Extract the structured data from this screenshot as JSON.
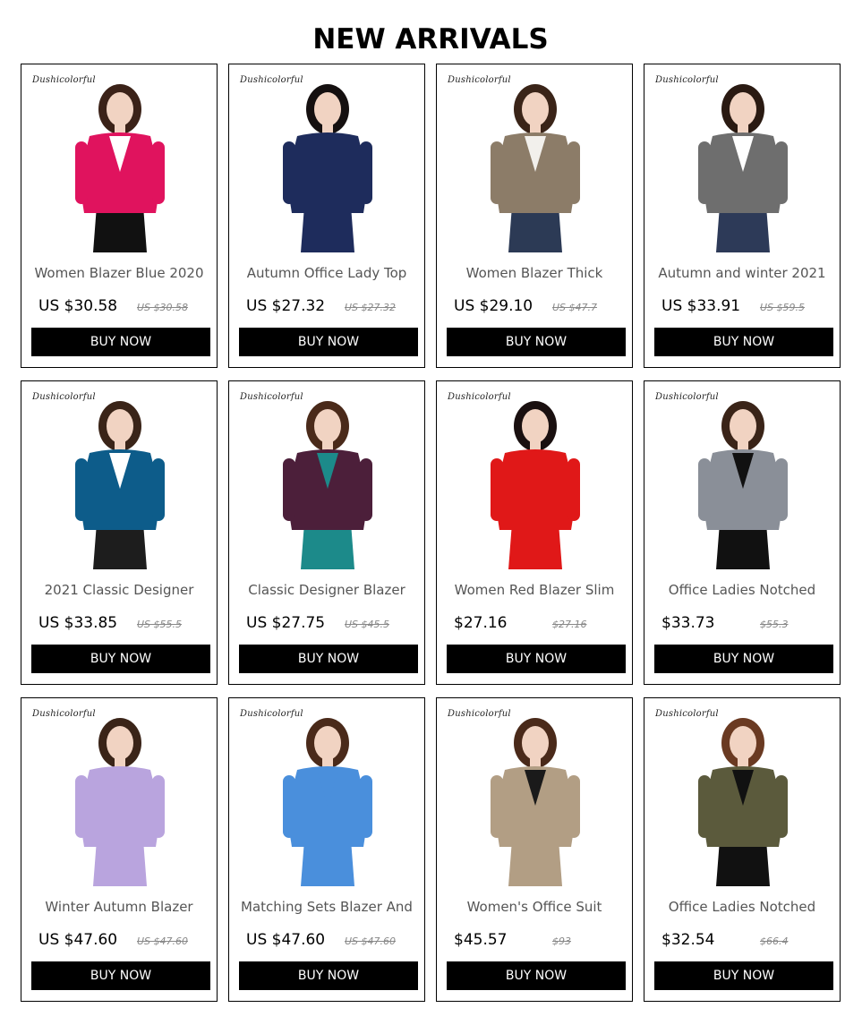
{
  "page": {
    "title": "NEW ARRIVALS"
  },
  "brand": "Dushicolorful",
  "buy_label": "BUY NOW",
  "products": [
    {
      "title": "Women Blazer Blue 2020",
      "price": "US $30.58",
      "old_price": "US $30.58",
      "jacket": "#e0135e",
      "inner": "#ffffff",
      "bottom": "#111111",
      "hair": "#3b2218",
      "hat": ""
    },
    {
      "title": "Autumn Office Lady Top",
      "price": "US $27.32",
      "old_price": "US $27.32",
      "jacket": "#1e2c5c",
      "inner": "#1e2c5c",
      "bottom": "#1e2c5c",
      "hair": "#151010",
      "hat": ""
    },
    {
      "title": "Women Blazer Thick",
      "price": "US $29.10",
      "old_price": "US $47.7",
      "jacket": "#8c7c68",
      "inner": "#f2f0ec",
      "bottom": "#2c3a55",
      "hair": "#3a2418",
      "hat": "#d8c29a"
    },
    {
      "title": "Autumn and winter 2021",
      "price": "US $33.91",
      "old_price": "US $59.5",
      "jacket": "#6e6e6e",
      "inner": "#ffffff",
      "bottom": "#2d3a58",
      "hair": "#2a1a12",
      "hat": "#111111"
    },
    {
      "title": "2021 Classic Designer",
      "price": "US $33.85",
      "old_price": "US $55.5",
      "jacket": "#0d5c8a",
      "inner": "#ffffff",
      "bottom": "#1d1d1d",
      "hair": "#3a2418",
      "hat": "#e6dccb"
    },
    {
      "title": "Classic Designer Blazer",
      "price": "US $27.75",
      "old_price": "US $45.5",
      "jacket": "#4c1f3a",
      "inner": "#1c8a8a",
      "bottom": "#1c8a8a",
      "hair": "#4a2a1a",
      "hat": ""
    },
    {
      "title": "Women Red Blazer Slim",
      "price": "$27.16",
      "old_price": "$27.16",
      "jacket": "#e01818",
      "inner": "#e01818",
      "bottom": "#e01818",
      "hair": "#1a1010",
      "hat": ""
    },
    {
      "title": "Office Ladies Notched",
      "price": "$33.73",
      "old_price": "$55.3",
      "jacket": "#8a8f98",
      "inner": "#111111",
      "bottom": "#111111",
      "hair": "#3a2418",
      "hat": "#151515"
    },
    {
      "title": "Winter Autumn Blazer",
      "price": "US $47.60",
      "old_price": "US $47.60",
      "jacket": "#b9a4de",
      "inner": "#b9a4de",
      "bottom": "#b9a4de",
      "hair": "#3a2418",
      "hat": ""
    },
    {
      "title": "Matching Sets Blazer And",
      "price": "US $47.60",
      "old_price": "US $47.60",
      "jacket": "#4a8fdc",
      "inner": "#4a8fdc",
      "bottom": "#4a8fdc",
      "hair": "#4a2a1a",
      "hat": ""
    },
    {
      "title": "Women's Office Suit",
      "price": "$45.57",
      "old_price": "$93",
      "jacket": "#b29e84",
      "inner": "#1a1a1a",
      "bottom": "#b29e84",
      "hair": "#4a2a1a",
      "hat": ""
    },
    {
      "title": "Office Ladies Notched",
      "price": "$32.54",
      "old_price": "$66.4",
      "jacket": "#5b5a3c",
      "inner": "#111111",
      "bottom": "#111111",
      "hair": "#6a3a22",
      "hat": ""
    }
  ]
}
